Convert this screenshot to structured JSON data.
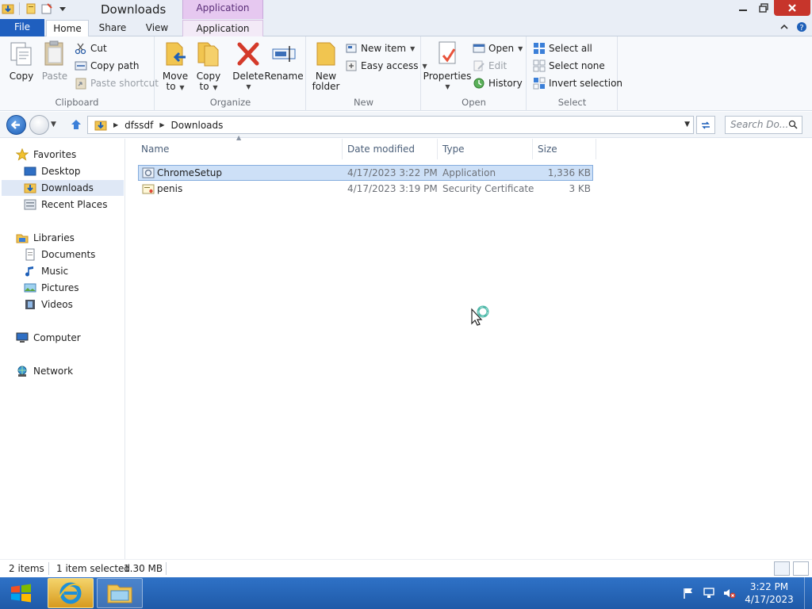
{
  "window": {
    "title": "Downloads",
    "contextual_tab_group": "Application Tools"
  },
  "ribbon_tabs": {
    "file": "File",
    "home": "Home",
    "share": "Share",
    "view": "View",
    "application": "Application"
  },
  "clipboard": {
    "label": "Clipboard",
    "copy": "Copy",
    "paste": "Paste",
    "cut": "Cut",
    "copy_path": "Copy path",
    "paste_shortcut": "Paste shortcut"
  },
  "organize": {
    "label": "Organize",
    "move_to_1": "Move",
    "move_to_2": "to",
    "copy_to_1": "Copy",
    "copy_to_2": "to",
    "delete": "Delete",
    "rename": "Rename"
  },
  "new_group": {
    "label": "New",
    "new_folder_1": "New",
    "new_folder_2": "folder",
    "new_item": "New item",
    "easy_access": "Easy access"
  },
  "open_group": {
    "label": "Open",
    "properties": "Properties",
    "open": "Open",
    "edit": "Edit",
    "history": "History"
  },
  "select_group": {
    "label": "Select",
    "select_all": "Select all",
    "select_none": "Select none",
    "invert_selection": "Invert selection"
  },
  "address": {
    "segments": [
      "dfssdf",
      "Downloads"
    ],
    "search_placeholder": "Search Do..."
  },
  "nav_pane": {
    "favorites": "Favorites",
    "desktop": "Desktop",
    "downloads": "Downloads",
    "recent_places": "Recent Places",
    "libraries": "Libraries",
    "documents": "Documents",
    "music": "Music",
    "pictures": "Pictures",
    "videos": "Videos",
    "computer": "Computer",
    "network": "Network"
  },
  "columns": {
    "name": "Name",
    "date_modified": "Date modified",
    "type": "Type",
    "size": "Size"
  },
  "files": [
    {
      "name": "ChromeSetup",
      "date": "4/17/2023 3:22 PM",
      "type": "Application",
      "size": "1,336 KB",
      "selected": true
    },
    {
      "name": "penis",
      "date": "4/17/2023 3:19 PM",
      "type": "Security Certificate",
      "size": "3 KB",
      "selected": false
    }
  ],
  "status": {
    "item_count": "2 items",
    "selection": "1 item selected",
    "selection_size": "1.30 MB"
  },
  "taskbar": {
    "time": "3:22 PM",
    "date": "4/17/2023"
  },
  "colors": {
    "file_tab": "#1f5fbf",
    "contextual_tab": "#e6c8f0",
    "selection": "#cde0f7",
    "taskbar": "#2766b8",
    "close_button": "#c7352b"
  }
}
